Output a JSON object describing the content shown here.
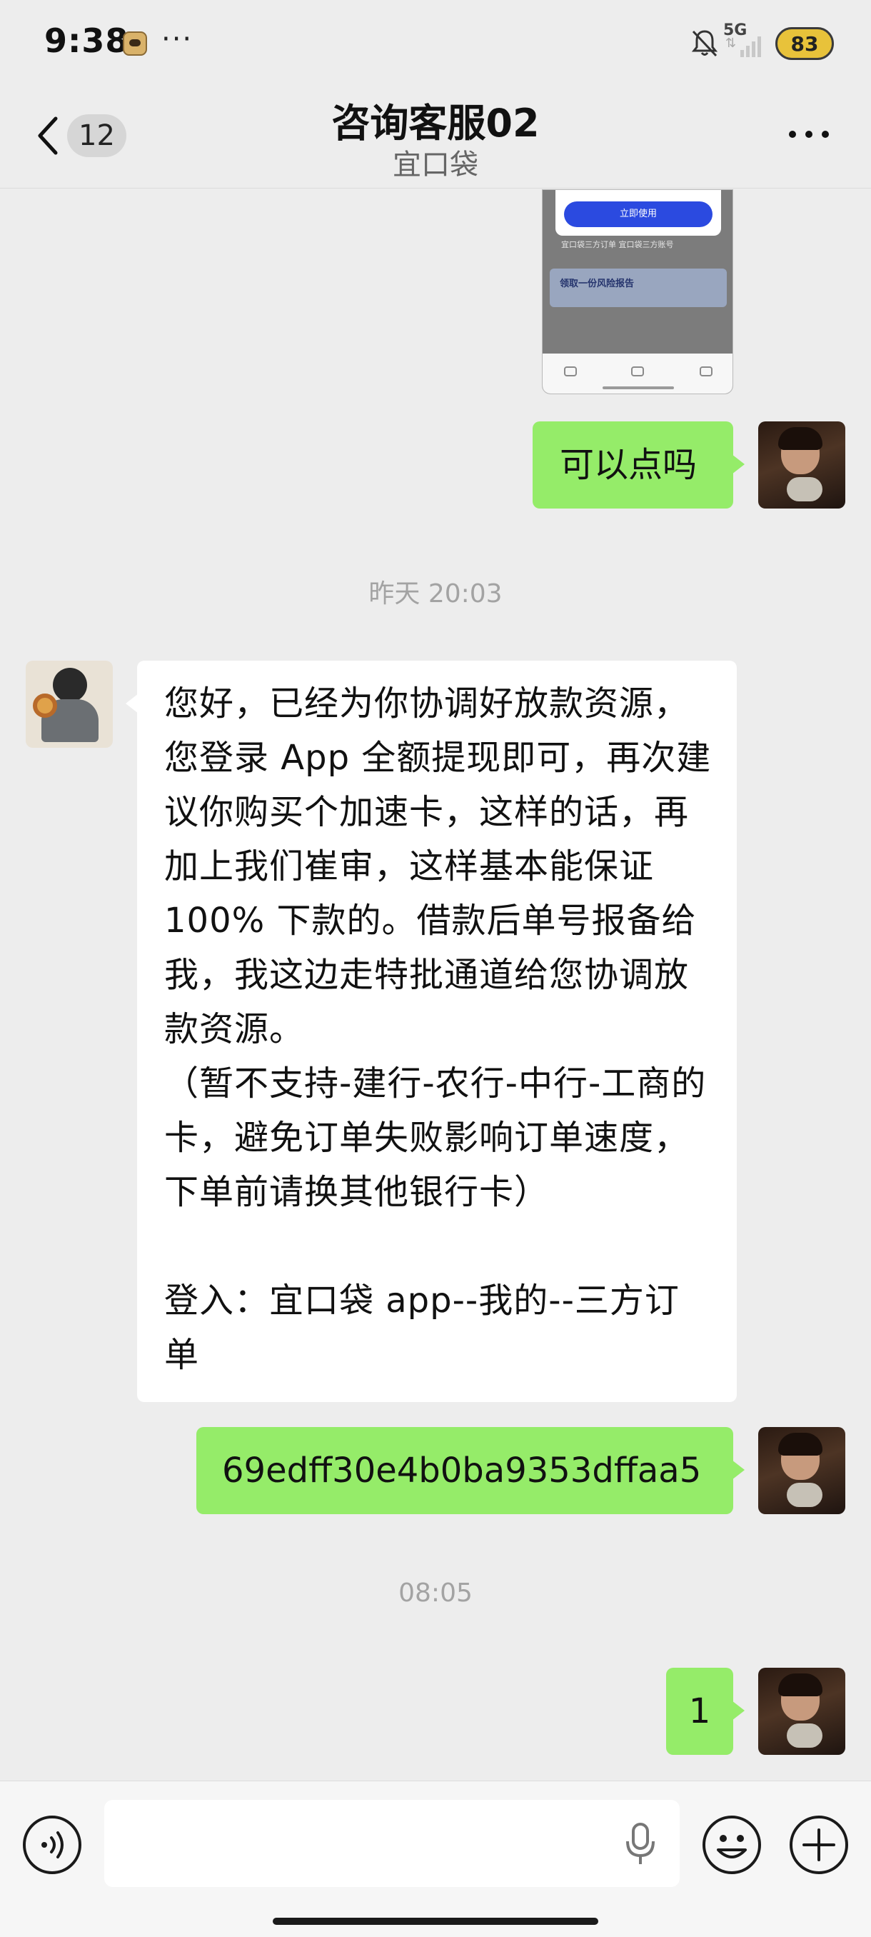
{
  "status_bar": {
    "time": "9:38",
    "more": "···",
    "network": "5G",
    "battery": "83"
  },
  "nav": {
    "back_count": "12",
    "title": "咨询客服02",
    "subtitle": "宜口袋"
  },
  "shared_image": {
    "button": "立即使用",
    "row_text": "宜口袋三方订单    宜口袋三方账号",
    "banner_text": "领取一份风险报告"
  },
  "messages": [
    {
      "from": "me",
      "type": "text",
      "text": "可以点吗"
    },
    {
      "type": "timestamp",
      "text": "昨天 20:03"
    },
    {
      "from": "them",
      "type": "text",
      "text": "您好，已经为你协调好放款资源，\n您登录 App 全额提现即可，再次建\n议你购买个加速卡，这样的话，再\n加上我们崔审，这样基本能保证\n100% 下款的。借款后单号报备给\n我，我这边走特批通道给您协调放\n款资源。\n（暂不支持-建行-农行-中行-工商的\n卡，避免订单失败影响订单速度，\n下单前请换其他银行卡）\n\n登入：宜口袋 app--我的--三方订\n单"
    },
    {
      "from": "me",
      "type": "text",
      "text": "69edff30e4b0ba9353dffaa5"
    },
    {
      "type": "timestamp",
      "text": "08:05"
    },
    {
      "from": "me",
      "type": "text",
      "text": "1"
    }
  ],
  "input": {
    "placeholder": ""
  },
  "icons": [
    "back-icon",
    "more-icon",
    "voice-icon",
    "mic-icon",
    "emoji-icon",
    "plus-icon",
    "mute-icon",
    "signal-icon"
  ],
  "colors": {
    "my_bubble": "#95ec69",
    "their_bubble": "#ffffff",
    "background": "#ededed"
  }
}
